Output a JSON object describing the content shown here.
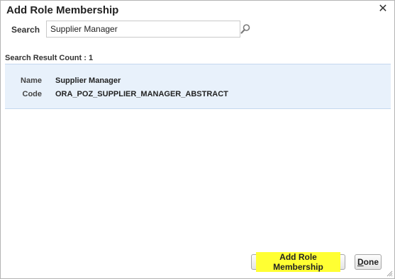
{
  "dialog": {
    "title": "Add Role Membership",
    "close_icon": "close-icon"
  },
  "search": {
    "label": "Search",
    "value": "Supplier Manager",
    "icon": "search-icon"
  },
  "results": {
    "count_text": "Search Result Count : 1",
    "items": [
      {
        "name_label": "Name",
        "name": "Supplier Manager",
        "code_label": "Code",
        "code": "ORA_POZ_SUPPLIER_MANAGER_ABSTRACT"
      }
    ]
  },
  "footer": {
    "add_button_label": "Add Role Membership",
    "done_button_first": "D",
    "done_button_rest": "one"
  },
  "colors": {
    "result_bg": "#e8f1fb",
    "highlight": "#ffff33"
  }
}
